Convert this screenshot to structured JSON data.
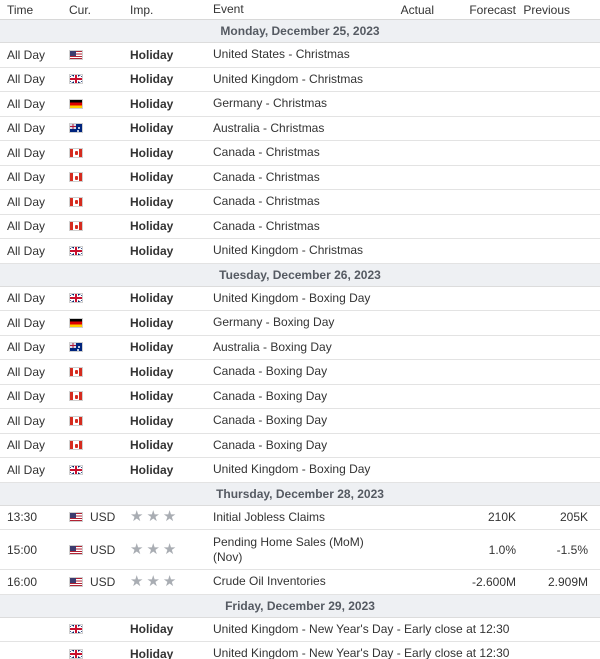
{
  "header": {
    "time": "Time",
    "currency": "Cur.",
    "importance": "Imp.",
    "event": "Event",
    "actual": "Actual",
    "forecast": "Forecast",
    "previous": "Previous"
  },
  "star_glyph": "★",
  "days": [
    {
      "date": "Monday, December 25, 2023",
      "events": [
        {
          "time": "All Day",
          "flag": "us",
          "currency": "",
          "importance": "Holiday",
          "event": "United States - Christmas",
          "actual": "",
          "forecast": "",
          "previous": ""
        },
        {
          "time": "All Day",
          "flag": "gb",
          "currency": "",
          "importance": "Holiday",
          "event": "United Kingdom - Christmas",
          "actual": "",
          "forecast": "",
          "previous": ""
        },
        {
          "time": "All Day",
          "flag": "de",
          "currency": "",
          "importance": "Holiday",
          "event": "Germany - Christmas",
          "actual": "",
          "forecast": "",
          "previous": ""
        },
        {
          "time": "All Day",
          "flag": "au",
          "currency": "",
          "importance": "Holiday",
          "event": "Australia - Christmas",
          "actual": "",
          "forecast": "",
          "previous": ""
        },
        {
          "time": "All Day",
          "flag": "ca",
          "currency": "",
          "importance": "Holiday",
          "event": "Canada - Christmas",
          "actual": "",
          "forecast": "",
          "previous": ""
        },
        {
          "time": "All Day",
          "flag": "ca",
          "currency": "",
          "importance": "Holiday",
          "event": "Canada - Christmas",
          "actual": "",
          "forecast": "",
          "previous": ""
        },
        {
          "time": "All Day",
          "flag": "ca",
          "currency": "",
          "importance": "Holiday",
          "event": "Canada - Christmas",
          "actual": "",
          "forecast": "",
          "previous": ""
        },
        {
          "time": "All Day",
          "flag": "ca",
          "currency": "",
          "importance": "Holiday",
          "event": "Canada - Christmas",
          "actual": "",
          "forecast": "",
          "previous": ""
        },
        {
          "time": "All Day",
          "flag": "gb",
          "currency": "",
          "importance": "Holiday",
          "event": "United Kingdom - Christmas",
          "actual": "",
          "forecast": "",
          "previous": ""
        }
      ]
    },
    {
      "date": "Tuesday, December 26, 2023",
      "events": [
        {
          "time": "All Day",
          "flag": "gb",
          "currency": "",
          "importance": "Holiday",
          "event": "United Kingdom - Boxing Day",
          "actual": "",
          "forecast": "",
          "previous": ""
        },
        {
          "time": "All Day",
          "flag": "de",
          "currency": "",
          "importance": "Holiday",
          "event": "Germany - Boxing Day",
          "actual": "",
          "forecast": "",
          "previous": ""
        },
        {
          "time": "All Day",
          "flag": "au",
          "currency": "",
          "importance": "Holiday",
          "event": "Australia - Boxing Day",
          "actual": "",
          "forecast": "",
          "previous": ""
        },
        {
          "time": "All Day",
          "flag": "ca",
          "currency": "",
          "importance": "Holiday",
          "event": "Canada - Boxing Day",
          "actual": "",
          "forecast": "",
          "previous": ""
        },
        {
          "time": "All Day",
          "flag": "ca",
          "currency": "",
          "importance": "Holiday",
          "event": "Canada - Boxing Day",
          "actual": "",
          "forecast": "",
          "previous": ""
        },
        {
          "time": "All Day",
          "flag": "ca",
          "currency": "",
          "importance": "Holiday",
          "event": "Canada - Boxing Day",
          "actual": "",
          "forecast": "",
          "previous": ""
        },
        {
          "time": "All Day",
          "flag": "ca",
          "currency": "",
          "importance": "Holiday",
          "event": "Canada - Boxing Day",
          "actual": "",
          "forecast": "",
          "previous": ""
        },
        {
          "time": "All Day",
          "flag": "gb",
          "currency": "",
          "importance": "Holiday",
          "event": "United Kingdom - Boxing Day",
          "actual": "",
          "forecast": "",
          "previous": ""
        }
      ]
    },
    {
      "date": "Thursday, December 28, 2023",
      "events": [
        {
          "time": "13:30",
          "flag": "us",
          "currency": "USD",
          "stars": 3,
          "event": "Initial Jobless Claims",
          "actual": "",
          "forecast": "210K",
          "previous": "205K"
        },
        {
          "time": "15:00",
          "flag": "us",
          "currency": "USD",
          "stars": 3,
          "event": "Pending Home Sales (MoM) (Nov)",
          "actual": "",
          "forecast": "1.0%",
          "previous": "-1.5%",
          "tall": true
        },
        {
          "time": "16:00",
          "flag": "us",
          "currency": "USD",
          "stars": 3,
          "event": "Crude Oil Inventories",
          "actual": "",
          "forecast": "-2.600M",
          "previous": "2.909M"
        }
      ]
    },
    {
      "date": "Friday, December 29, 2023",
      "events": [
        {
          "time": "",
          "flag": "gb",
          "currency": "",
          "importance": "Holiday",
          "event": "United Kingdom - New Year's Day - Early close at 12:30",
          "actual": "",
          "forecast": "",
          "previous": "",
          "nowrap": true
        },
        {
          "time": "",
          "flag": "gb",
          "currency": "",
          "importance": "Holiday",
          "event": "United Kingdom - New Year's Day - Early close at 12:30",
          "actual": "",
          "forecast": "",
          "previous": "",
          "nowrap": true
        }
      ]
    }
  ]
}
